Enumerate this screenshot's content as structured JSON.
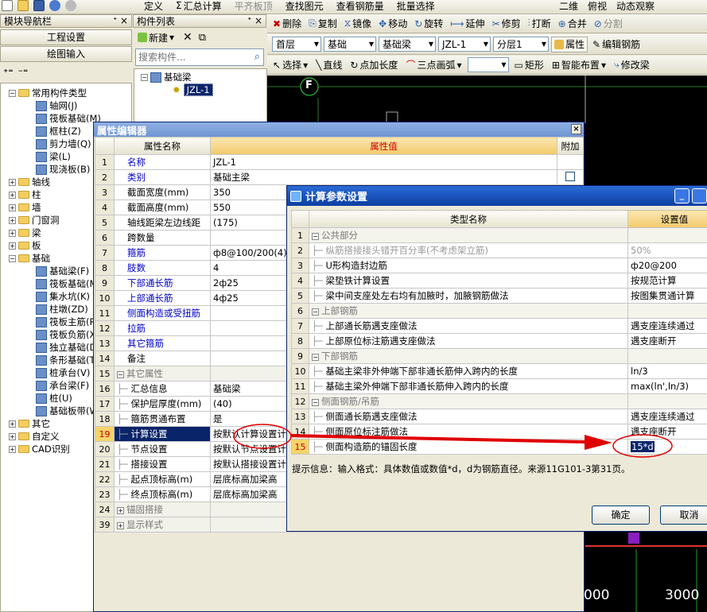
{
  "main_toolbar": {
    "items": [
      "定义",
      "汇总计算",
      "平齐板顶",
      "查找图元",
      "查看钢筋量",
      "批量选择"
    ],
    "right_items": [
      "二维",
      "俯视",
      "动态观察"
    ]
  },
  "nav_panel": {
    "title": "模块导航栏",
    "buttons": [
      "工程设置",
      "绘图输入"
    ],
    "tree": [
      {
        "label": "常用构件类型",
        "level": 0,
        "expand": "-",
        "kind": "folder"
      },
      {
        "label": "轴网(J)",
        "level": 1,
        "kind": "comp"
      },
      {
        "label": "筏板基础(M)",
        "level": 1,
        "kind": "comp"
      },
      {
        "label": "框柱(Z)",
        "level": 1,
        "kind": "comp"
      },
      {
        "label": "剪力墙(Q)",
        "level": 1,
        "kind": "comp"
      },
      {
        "label": "梁(L)",
        "level": 1,
        "kind": "comp"
      },
      {
        "label": "现浇板(B)",
        "level": 1,
        "kind": "comp"
      },
      {
        "label": "轴线",
        "level": 0,
        "expand": "+",
        "kind": "folder"
      },
      {
        "label": "柱",
        "level": 0,
        "expand": "+",
        "kind": "folder"
      },
      {
        "label": "墙",
        "level": 0,
        "expand": "+",
        "kind": "folder"
      },
      {
        "label": "门窗洞",
        "level": 0,
        "expand": "+",
        "kind": "folder"
      },
      {
        "label": "梁",
        "level": 0,
        "expand": "+",
        "kind": "folder"
      },
      {
        "label": "板",
        "level": 0,
        "expand": "+",
        "kind": "folder"
      },
      {
        "label": "基础",
        "level": 0,
        "expand": "-",
        "kind": "folder"
      },
      {
        "label": "基础梁(F)",
        "level": 1,
        "kind": "comp"
      },
      {
        "label": "筏板基础(M)",
        "level": 1,
        "kind": "comp"
      },
      {
        "label": "集水坑(K)",
        "level": 1,
        "kind": "comp"
      },
      {
        "label": "柱墩(ZD)",
        "level": 1,
        "kind": "comp"
      },
      {
        "label": "筏板主筋(R)",
        "level": 1,
        "kind": "comp"
      },
      {
        "label": "筏板负筋(X)",
        "level": 1,
        "kind": "comp"
      },
      {
        "label": "独立基础(D)",
        "level": 1,
        "kind": "comp"
      },
      {
        "label": "条形基础(T)",
        "level": 1,
        "kind": "comp"
      },
      {
        "label": "桩承台(V)",
        "level": 1,
        "kind": "comp"
      },
      {
        "label": "承台梁(F)",
        "level": 1,
        "kind": "comp"
      },
      {
        "label": "桩(U)",
        "level": 1,
        "kind": "comp"
      },
      {
        "label": "基础板带(W)",
        "level": 1,
        "kind": "comp"
      },
      {
        "label": "其它",
        "level": 0,
        "expand": "+",
        "kind": "folder"
      },
      {
        "label": "自定义",
        "level": 0,
        "expand": "+",
        "kind": "folder"
      },
      {
        "label": "CAD识别",
        "level": 0,
        "expand": "+",
        "kind": "folder"
      }
    ]
  },
  "comp_list": {
    "title": "构件列表",
    "new_label": "新建",
    "search_placeholder": "搜索构件...",
    "root": "基础梁",
    "child": "JZL-1"
  },
  "edit_toolbar": [
    "删除",
    "复制",
    "镜像",
    "移动",
    "旋转",
    "延伸",
    "修剪",
    "打断",
    "合并",
    "分割"
  ],
  "selector_bar": {
    "floor": "首层",
    "category": "基础",
    "type": "基础梁",
    "component": "JZL-1",
    "layer": "分层1",
    "attr_button": "属性",
    "edit_rebar_button": "编辑钢筋"
  },
  "draw_toolbar": [
    "选择",
    "直线",
    "点加长度",
    "三点画弧",
    "矩形",
    "智能布置",
    "修改梁"
  ],
  "canvas": {
    "axis_label": "F",
    "dim_left": "000",
    "dim_right": "3000"
  },
  "prop_editor": {
    "title": "属性编辑器",
    "headers": {
      "name": "属性名称",
      "value": "属性值",
      "extra": "附加"
    },
    "rows": [
      {
        "num": "1",
        "name": "名称",
        "value": "JZL-1",
        "style": "blue"
      },
      {
        "num": "2",
        "name": "类别",
        "value": "基础主梁",
        "style": "blue"
      },
      {
        "num": "3",
        "name": "截面宽度(mm)",
        "value": "350",
        "style": "plain"
      },
      {
        "num": "4",
        "name": "截面高度(mm)",
        "value": "550",
        "style": "plain"
      },
      {
        "num": "5",
        "name": "轴线距梁左边线距",
        "value": "(175)",
        "style": "plain"
      },
      {
        "num": "6",
        "name": "跨数量",
        "value": "",
        "style": "plain"
      },
      {
        "num": "7",
        "name": "箍筋",
        "value": "ф8@100/200(4)",
        "style": "blue"
      },
      {
        "num": "8",
        "name": "肢数",
        "value": "4",
        "style": "blue"
      },
      {
        "num": "9",
        "name": "下部通长筋",
        "value": "2ф25",
        "style": "blue"
      },
      {
        "num": "10",
        "name": "上部通长筋",
        "value": "4ф25",
        "style": "blue"
      },
      {
        "num": "11",
        "name": "侧面构造或受扭筋",
        "value": "",
        "style": "blue"
      },
      {
        "num": "12",
        "name": "拉筋",
        "value": "",
        "style": "blue"
      },
      {
        "num": "13",
        "name": "其它箍筋",
        "value": "",
        "style": "blue"
      },
      {
        "num": "14",
        "name": "备注",
        "value": "",
        "style": "plain"
      },
      {
        "num": "15",
        "name": "其它属性",
        "value": "",
        "style": "group",
        "expand": "-"
      },
      {
        "num": "16",
        "name": "汇总信息",
        "value": "基础梁",
        "style": "child"
      },
      {
        "num": "17",
        "name": "保护层厚度(mm)",
        "value": "(40)",
        "style": "child"
      },
      {
        "num": "18",
        "name": "箍筋贯通布置",
        "value": "是",
        "style": "child"
      },
      {
        "num": "19",
        "name": "计算设置",
        "value": "按默认计算设置计",
        "style": "selected"
      },
      {
        "num": "20",
        "name": "节点设置",
        "value": "按默认节点设置计",
        "style": "child"
      },
      {
        "num": "21",
        "name": "搭接设置",
        "value": "按默认搭接设置计",
        "style": "child"
      },
      {
        "num": "22",
        "name": "起点顶标高(m)",
        "value": "层底标高加梁高",
        "style": "child"
      },
      {
        "num": "23",
        "name": "终点顶标高(m)",
        "value": "层底标高加梁高",
        "style": "child"
      },
      {
        "num": "24",
        "name": "锚固搭接",
        "value": "",
        "style": "group",
        "expand": "+"
      },
      {
        "num": "39",
        "name": "显示样式",
        "value": "",
        "style": "group",
        "expand": "+"
      }
    ]
  },
  "calc_dialog": {
    "title": "计算参数设置",
    "headers": {
      "name": "类型名称",
      "value": "设置值"
    },
    "rows": [
      {
        "num": "1",
        "name": "公共部分",
        "value": "",
        "style": "group"
      },
      {
        "num": "2",
        "name": "纵筋搭接接头错开百分率(不考虑架立筋)",
        "value": "50%",
        "style": "disabled"
      },
      {
        "num": "3",
        "name": "U形构造封边筋",
        "value": "ф20@200",
        "style": "item"
      },
      {
        "num": "4",
        "name": "梁垫铁计算设置",
        "value": "按规范计算",
        "style": "item"
      },
      {
        "num": "5",
        "name": "梁中间支座处左右均有加腋时，加腋钢筋做法",
        "value": "按图集贯通计算",
        "style": "item"
      },
      {
        "num": "6",
        "name": "上部钢筋",
        "value": "",
        "style": "group"
      },
      {
        "num": "7",
        "name": "上部通长筋遇支座做法",
        "value": "遇支座连续通过",
        "style": "item"
      },
      {
        "num": "8",
        "name": "上部原位标注筋遇支座做法",
        "value": "遇支座断开",
        "style": "item"
      },
      {
        "num": "9",
        "name": "下部钢筋",
        "value": "",
        "style": "group"
      },
      {
        "num": "10",
        "name": "基础主梁非外伸端下部非通长筋伸入跨内的长度",
        "value": "ln/3",
        "style": "item"
      },
      {
        "num": "11",
        "name": "基础主梁外伸端下部非通长筋伸入跨内的长度",
        "value": "max(ln',ln/3)",
        "style": "item"
      },
      {
        "num": "12",
        "name": "侧面钢筋/吊筋",
        "value": "",
        "style": "group"
      },
      {
        "num": "13",
        "name": "侧面通长筋遇支座做法",
        "value": "遇支座连续通过",
        "style": "item"
      },
      {
        "num": "14",
        "name": "侧面原位标注筋做法",
        "value": "遇支座断开",
        "style": "item"
      },
      {
        "num": "15",
        "name": "侧面构造筋的锚固长度",
        "value": "15*d",
        "style": "selected"
      }
    ],
    "hint": "提示信息：输入格式：具体数值或数值*d，d为钢筋直径。来源11G101-3第31页。",
    "ok": "确定",
    "cancel": "取消"
  },
  "colors": {
    "annotation_red": "#e00000",
    "title_blue": "#0a3fa4",
    "selection": "#0a246a"
  }
}
